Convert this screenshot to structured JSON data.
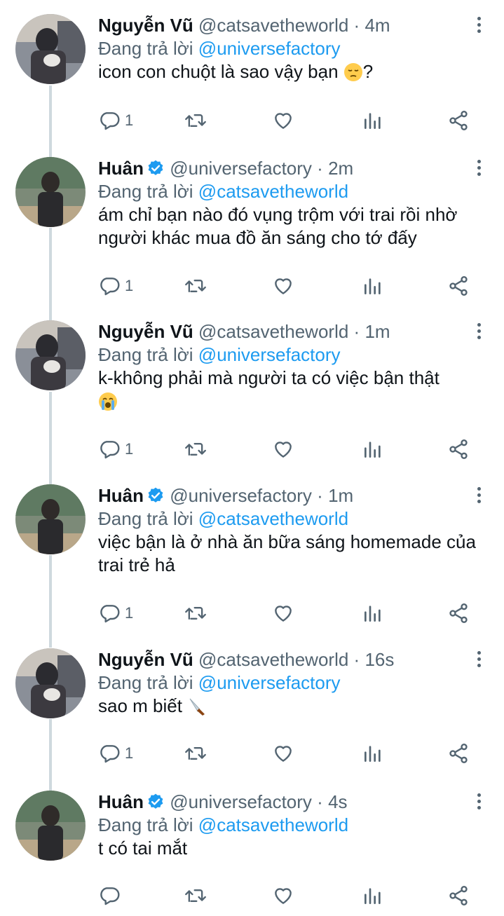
{
  "colors": {
    "accent": "#1d9bf0",
    "secondary_text": "#536471",
    "primary_text": "#0f1419",
    "thread_line": "#cfd9de"
  },
  "tweets": [
    {
      "name": "Nguyễn Vũ",
      "verified": false,
      "handle": "@catsavetheworld",
      "dot": "·",
      "time": "4m",
      "replying_prefix": "Đang trả lời",
      "replying_to": "@universefactory",
      "text": "icon con chuột là sao vậy bạn",
      "text_tail": "?",
      "emoji": "pensive-face-emoji",
      "reply_count": "1"
    },
    {
      "name": "Huân",
      "verified": true,
      "handle": "@universefactory",
      "dot": "·",
      "time": "2m",
      "replying_prefix": "Đang trả lời",
      "replying_to": "@catsavetheworld",
      "text": "ám chỉ bạn nào đó vụng trộm với trai rồi nhờ người khác mua đồ ăn sáng cho tớ đấy",
      "reply_count": "1"
    },
    {
      "name": "Nguyễn Vũ",
      "verified": false,
      "handle": "@catsavetheworld",
      "dot": "·",
      "time": "1m",
      "replying_prefix": "Đang trả lời",
      "replying_to": "@universefactory",
      "text": "k-không phải mà người ta có việc bận thật",
      "emoji": "loudly-crying-face-emoji",
      "reply_count": "1"
    },
    {
      "name": "Huân",
      "verified": true,
      "handle": "@universefactory",
      "dot": "·",
      "time": "1m",
      "replying_prefix": "Đang trả lời",
      "replying_to": "@catsavetheworld",
      "text": "việc bận là ở nhà ăn bữa sáng homemade của trai trẻ hả",
      "reply_count": "1"
    },
    {
      "name": "Nguyễn Vũ",
      "verified": false,
      "handle": "@catsavetheworld",
      "dot": "·",
      "time": "16s",
      "replying_prefix": "Đang trả lời",
      "replying_to": "@universefactory",
      "text": "sao m biết",
      "emoji": "knife-emoji",
      "reply_count": "1"
    },
    {
      "name": "Huân",
      "verified": true,
      "handle": "@universefactory",
      "dot": "·",
      "time": "4s",
      "replying_prefix": "Đang trả lời",
      "replying_to": "@catsavetheworld",
      "text": "t có tai mắt",
      "reply_count": ""
    }
  ],
  "icons": {
    "reply": "reply-icon",
    "retweet": "retweet-icon",
    "like": "heart-icon",
    "views": "analytics-icon",
    "share": "share-icon",
    "more": "more-vertical-icon",
    "verified": "verified-badge-icon"
  }
}
